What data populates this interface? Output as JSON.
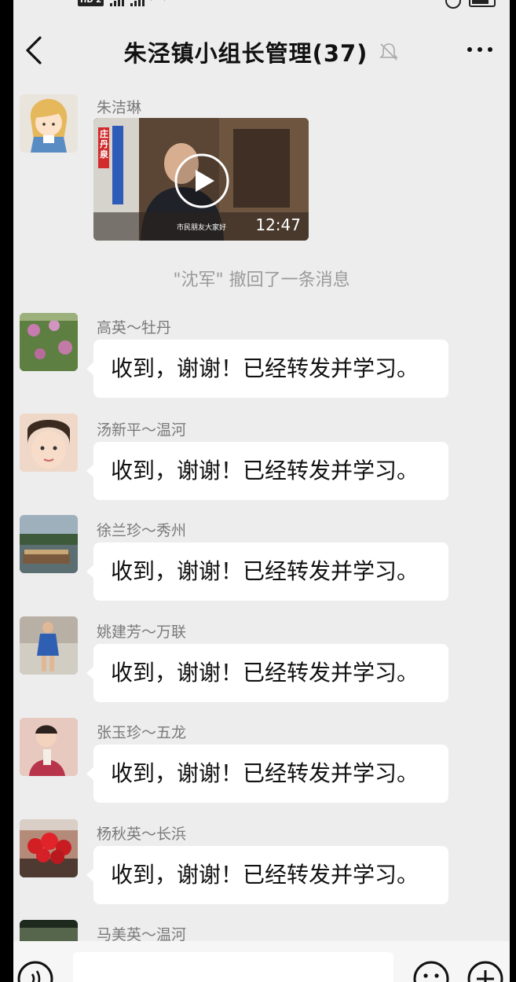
{
  "status_bar": {
    "hd_badge": "HD 2"
  },
  "header": {
    "title": "朱泾镇小组长管理(37)",
    "back_icon": "chevron-left-icon",
    "mute_icon": "bell-off-icon",
    "more_icon": "more-dots-icon"
  },
  "video_message": {
    "sender": "朱洁琳",
    "duration": "12:47",
    "banner_text": "庄丹泉",
    "subtitle": "市民朋友大家好"
  },
  "system_notice": "\"沈军\" 撤回了一条消息",
  "messages": [
    {
      "sender": "高英～牡丹",
      "text": "收到，谢谢！已经转发并学习。"
    },
    {
      "sender": "汤新平～温河",
      "text": "收到，谢谢！已经转发并学习。"
    },
    {
      "sender": "徐兰珍～秀州",
      "text": "收到，谢谢！已经转发并学习。"
    },
    {
      "sender": "姚建芳～万联",
      "text": "收到，谢谢！已经转发并学习。"
    },
    {
      "sender": "张玉珍～五龙",
      "text": "收到，谢谢！已经转发并学习。"
    },
    {
      "sender": "杨秋英～长浜",
      "text": "收到，谢谢！已经转发并学习。"
    },
    {
      "sender": "马美英～温河",
      "text": ""
    }
  ],
  "input_bar": {
    "voice_icon": "voice-icon",
    "emoji_icon": "emoji-icon",
    "add_icon": "plus-circle-icon"
  },
  "colors": {
    "background": "#ededed",
    "bubble": "#ffffff",
    "sender": "#7a7a7a",
    "notice": "#9a9a9a"
  }
}
